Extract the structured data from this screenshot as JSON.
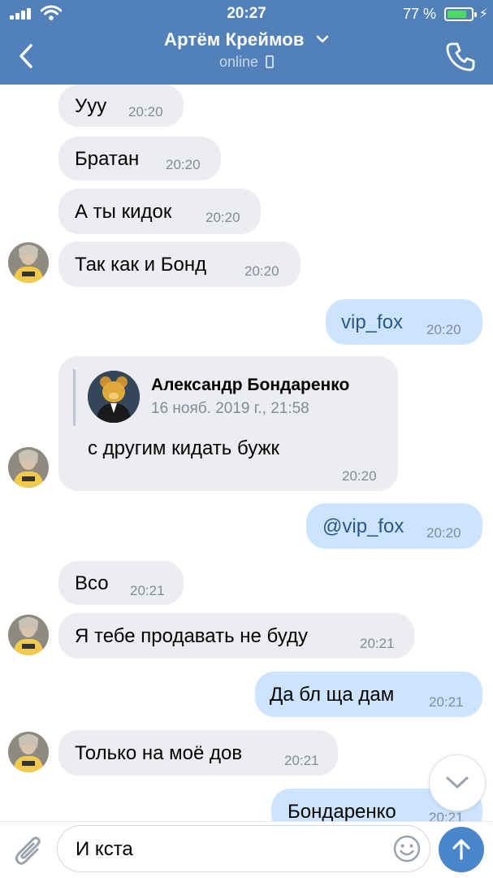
{
  "status_bar": {
    "time": "20:27",
    "battery": "77 %"
  },
  "header": {
    "title": "Артём Креймов",
    "subtitle": "online",
    "icons": {
      "back": "chevron-left-icon",
      "expand": "chevron-down-icon",
      "call": "phone-icon",
      "device": "mobile-device-icon"
    }
  },
  "messages": [
    {
      "text": "Ууу",
      "time": "20:20",
      "direction": "in"
    },
    {
      "text": "Братан",
      "time": "20:20",
      "direction": "in"
    },
    {
      "text": "А ты кидок",
      "time": "20:20",
      "direction": "in"
    },
    {
      "text": "Так как и Бонд",
      "time": "20:20",
      "direction": "in"
    },
    {
      "text": "vip_fox",
      "time": "20:20",
      "direction": "out"
    },
    {
      "text": "с другим кидать бужк",
      "time": "20:20",
      "direction": "in",
      "quote": {
        "author": "Александр Бондаренко",
        "date": "16 нояб. 2019 г., 21:58"
      }
    },
    {
      "text": "@vip_fox",
      "time": "20:20",
      "direction": "out"
    },
    {
      "text": "Всо",
      "time": "20:21",
      "direction": "in"
    },
    {
      "text": "Я тебе продавать не буду",
      "time": "20:21",
      "direction": "in"
    },
    {
      "text": "Да бл ща дам",
      "time": "20:21",
      "direction": "out"
    },
    {
      "text": "Только на моё дов",
      "time": "20:21",
      "direction": "in"
    },
    {
      "text": "Бондаренко",
      "time": "20:21",
      "direction": "out"
    }
  ],
  "composer": {
    "value": "И кста"
  },
  "colors": {
    "header": "#5181b8",
    "bubble_in": "#ebedf0",
    "bubble_out": "#cce4ff",
    "time": "#818c99",
    "send": "#4986cc"
  }
}
